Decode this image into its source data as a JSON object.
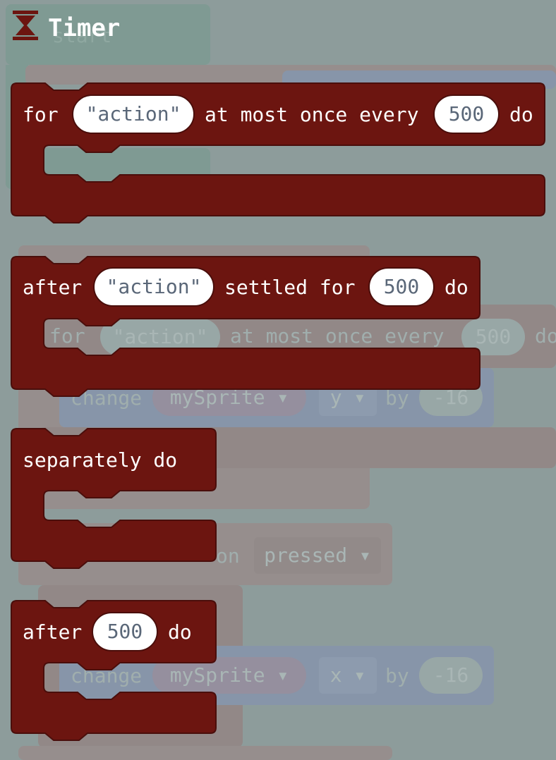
{
  "category": {
    "title": "Timer",
    "icon": "hourglass-icon",
    "color": "#6c1510"
  },
  "blocks": [
    {
      "id": "for_every",
      "parts": [
        "for",
        "\"action\"",
        "at most once every",
        "500",
        "do"
      ]
    },
    {
      "id": "after_settled",
      "parts": [
        "after",
        "\"action\"",
        "settled for",
        "500",
        "do"
      ]
    },
    {
      "id": "separately",
      "parts": [
        "separately do"
      ]
    },
    {
      "id": "after_ms",
      "parts": [
        "after",
        "500",
        "do"
      ]
    }
  ],
  "background_workspace": {
    "start_label": "start",
    "for_block": [
      "for",
      "\"action\"",
      "at most once every",
      "500",
      "do"
    ],
    "change_y": [
      "change",
      "mySprite ▾",
      "y ▾",
      "by",
      "-16"
    ],
    "button_pressed": [
      "on",
      "pressed ▾"
    ],
    "change_x": [
      "change",
      "mySprite ▾",
      "x ▾",
      "by",
      "-16"
    ]
  },
  "colors": {
    "block_fill": "#6c1510",
    "block_stroke": "#4a0e0b",
    "flyout_overlay": "#8d9c9b",
    "pill_text": "#5a6778"
  }
}
